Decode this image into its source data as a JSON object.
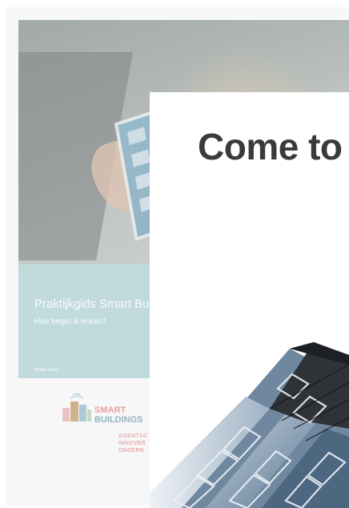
{
  "background_document": {
    "title": "Praktijkgids Smart Bu",
    "subtitle": "Hoe begin ik eraan?",
    "date": "Maart 2022",
    "logo": {
      "line1": "SMART",
      "line2": "BUILDINGS",
      "icon": "smart-buildings-logo-icon"
    },
    "agency_lines": [
      "AGENTSC",
      "INNOVER",
      "ONDERN"
    ]
  },
  "card": {
    "title": "Come to",
    "image": "building-facade-photo"
  },
  "colors": {
    "teal_band": "#a9cfd2",
    "card_title": "#3a3a3a",
    "logo_pink": "#e8a0a0",
    "logo_blue": "#94b4c2"
  }
}
